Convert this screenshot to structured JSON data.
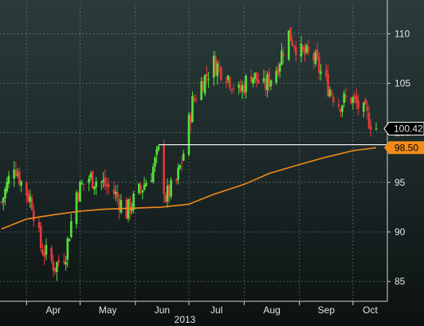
{
  "chart_data": {
    "type": "candlestick",
    "title": "",
    "xlabel": "",
    "ylabel": "",
    "year_label": "2013",
    "x_ticks": [
      "Apr",
      "May",
      "Jun",
      "Jul",
      "Aug",
      "Sep",
      "Oct"
    ],
    "ylim": [
      83,
      113
    ],
    "y_ticks": [
      85,
      90,
      95,
      100,
      105,
      110
    ],
    "grid": true,
    "axis_side": "right",
    "price_anchors": [
      [
        "2013-03-18",
        93.0
      ],
      [
        "2013-03-25",
        97.0
      ],
      [
        "2013-03-29",
        95.0
      ],
      [
        "2013-04-04",
        93.0
      ],
      [
        "2013-04-09",
        88.5
      ],
      [
        "2013-04-17",
        86.5
      ],
      [
        "2013-04-23",
        88.0
      ],
      [
        "2013-04-29",
        94.0
      ],
      [
        "2013-05-06",
        95.5
      ],
      [
        "2013-05-13",
        95.0
      ],
      [
        "2013-05-20",
        94.0
      ],
      [
        "2013-05-27",
        92.0
      ],
      [
        "2013-06-03",
        94.0
      ],
      [
        "2013-06-10",
        96.0
      ],
      [
        "2013-06-14",
        98.0
      ],
      [
        "2013-06-18",
        93.5
      ],
      [
        "2013-06-24",
        95.0
      ],
      [
        "2013-06-28",
        98.0
      ],
      [
        "2013-07-03",
        103.0
      ],
      [
        "2013-07-08",
        105.0
      ],
      [
        "2013-07-15",
        107.0
      ],
      [
        "2013-07-22",
        106.0
      ],
      [
        "2013-07-29",
        104.0
      ],
      [
        "2013-08-05",
        106.0
      ],
      [
        "2013-08-12",
        104.5
      ],
      [
        "2013-08-19",
        106.5
      ],
      [
        "2013-08-26",
        110.0
      ],
      [
        "2013-09-02",
        108.0
      ],
      [
        "2013-09-09",
        107.5
      ],
      [
        "2013-09-16",
        105.0
      ],
      [
        "2013-09-23",
        103.0
      ],
      [
        "2013-09-30",
        103.5
      ],
      [
        "2013-10-07",
        102.0
      ],
      [
        "2013-10-14",
        100.5
      ]
    ],
    "last_price": 100.42,
    "series": [
      {
        "name": "",
        "color": "#f28c1a",
        "type": "line",
        "points": [
          [
            "2013-03-18",
            90.3
          ],
          [
            "2013-04-01",
            91.3
          ],
          [
            "2013-04-15",
            91.7
          ],
          [
            "2013-05-01",
            92.1
          ],
          [
            "2013-05-15",
            92.3
          ],
          [
            "2013-06-01",
            92.4
          ],
          [
            "2013-06-15",
            92.5
          ],
          [
            "2013-07-01",
            92.8
          ],
          [
            "2013-07-15",
            93.8
          ],
          [
            "2013-08-01",
            94.8
          ],
          [
            "2013-08-15",
            95.9
          ],
          [
            "2013-09-01",
            96.8
          ],
          [
            "2013-09-15",
            97.5
          ],
          [
            "2013-10-01",
            98.2
          ],
          [
            "2013-10-14",
            98.5
          ]
        ]
      }
    ],
    "current_value_label": "100.42",
    "ma_value_label": "98.50",
    "reference_level": 98.8,
    "colors": {
      "up": "#55e23a",
      "down": "#e23a3a",
      "ma": "#f28c1a",
      "grid": "#9aa8a8",
      "label_box": "#ffffff",
      "ma_box": "#f28c1a"
    }
  }
}
